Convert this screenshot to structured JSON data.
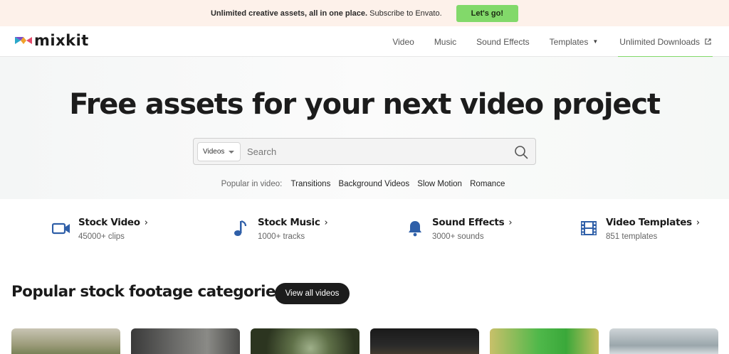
{
  "promo": {
    "message_bold": "Unlimited creative assets, all in one place.",
    "message_rest": " Subscribe to Envato.",
    "cta_label": "Let's go!"
  },
  "brand": {
    "name": "mixkit"
  },
  "nav": {
    "video": "Video",
    "music": "Music",
    "sound_effects": "Sound Effects",
    "templates": "Templates",
    "unlimited": "Unlimited Downloads"
  },
  "hero": {
    "title": "Free assets for your next video project",
    "search_type": "Videos",
    "search_placeholder": "Search",
    "popular_label": "Popular in video:",
    "popular_tags": [
      "Transitions",
      "Background Videos",
      "Slow Motion",
      "Romance"
    ]
  },
  "categories": [
    {
      "title": "Stock Video",
      "sub": "45000+ clips",
      "icon": "video-camera-icon"
    },
    {
      "title": "Stock Music",
      "sub": "1000+ tracks",
      "icon": "music-note-icon"
    },
    {
      "title": "Sound Effects",
      "sub": "3000+ sounds",
      "icon": "bell-icon"
    },
    {
      "title": "Video Templates",
      "sub": "851 templates",
      "icon": "film-strip-icon"
    }
  ],
  "section": {
    "title": "Popular stock footage categories",
    "view_all": "View all videos"
  },
  "colors": {
    "accent_green": "#82d96a",
    "icon_blue": "#2f5fa8",
    "promo_bg": "#fdf1ea"
  }
}
